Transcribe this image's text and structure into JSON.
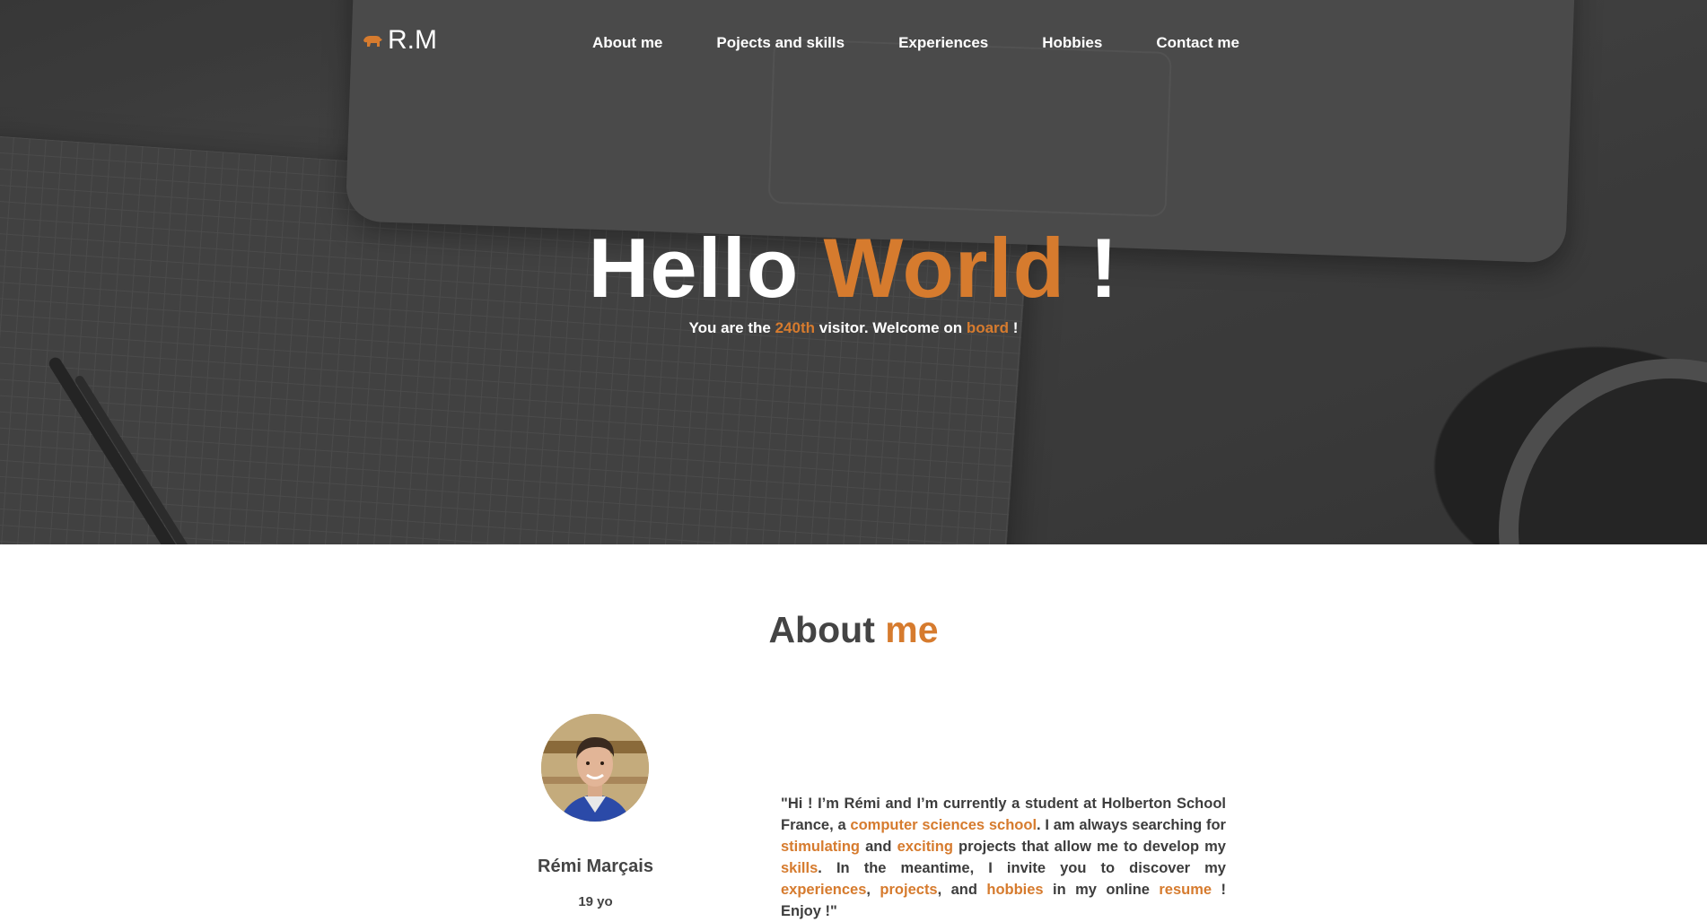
{
  "nav": {
    "logo_text": "R.M",
    "logo_icon": "bear-icon",
    "links": [
      "About me",
      "Pojects and skills",
      "Experiences",
      "Hobbies",
      "Contact me"
    ]
  },
  "hero": {
    "title_part1": "Hello",
    "title_accent": "World",
    "title_part2": "!",
    "sub_part1": "You are the",
    "visitor_count": "240th",
    "sub_part2": "visitor. Welcome on",
    "sub_accent": "board",
    "sub_part3": "!"
  },
  "about": {
    "title_part1": "About",
    "title_accent": "me",
    "name": "Rémi Marçais",
    "age": "19 yo",
    "bio": {
      "p1": "\"Hi ! I’m Rémi and I’m currently a student at Holberton School France, a",
      "h1": "computer sciences school",
      "p2": ". I am always searching for",
      "h2": "stimulating",
      "p3": "and",
      "h3": "exciting",
      "p4": "projects that allow me to develop my",
      "h4": "skills",
      "p5": ". In the meantime, I invite you to discover my",
      "h5": "experiences",
      "p6": ",",
      "h6": "projects",
      "p7": ", and",
      "h7": "hobbies",
      "p8": "in my online",
      "h8": "resume",
      "p9": "! Enjoy !\""
    }
  },
  "colors": {
    "accent": "#d67b2e",
    "dark_text": "#444444"
  }
}
